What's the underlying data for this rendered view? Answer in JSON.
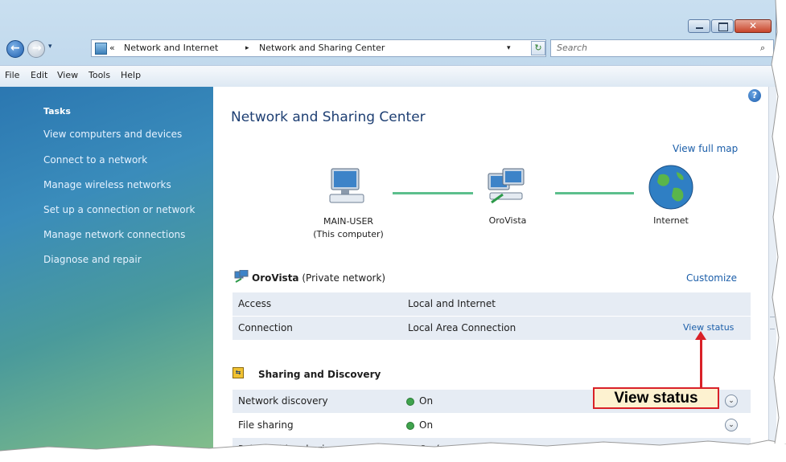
{
  "window": {
    "buttons": [
      "minimize",
      "maximize",
      "close"
    ]
  },
  "address": {
    "breadcrumb_prefix": "«",
    "crumb1": "Network and Internet",
    "sep": "▸",
    "crumb2": "Network and Sharing Center",
    "search_placeholder": "Search"
  },
  "menu": [
    "File",
    "Edit",
    "View",
    "Tools",
    "Help"
  ],
  "sidebar": {
    "heading": "Tasks",
    "items": [
      "View computers and devices",
      "Connect to a network",
      "Manage wireless networks",
      "Set up a connection or network",
      "Manage network connections",
      "Diagnose and repair"
    ]
  },
  "main": {
    "title": "Network and Sharing Center",
    "view_full_map": "View full map",
    "map": {
      "node1_line1": "MAIN-USER",
      "node1_line2": "(This computer)",
      "node2": "OroVista",
      "node3": "Internet"
    },
    "network": {
      "name": "OroVista",
      "type": "(Private network)",
      "customize": "Customize",
      "rows": [
        {
          "label": "Access",
          "value": "Local and Internet",
          "link": ""
        },
        {
          "label": "Connection",
          "value": "Local Area Connection",
          "link": "View status"
        }
      ]
    },
    "sharing": {
      "heading": "Sharing and Discovery",
      "rows": [
        {
          "label": "Network discovery",
          "value": "On"
        },
        {
          "label": "File sharing",
          "value": "On"
        },
        {
          "label": "Public folder sharing",
          "value": "On (read only)"
        }
      ]
    }
  },
  "callout": {
    "label": "View status",
    "color": "#d92128"
  },
  "colors": {
    "link": "#1b5ea9",
    "sidebar_text": "#e6f2ff",
    "connection_line": "#5cbf8c",
    "status_on": "#3fa34d"
  }
}
